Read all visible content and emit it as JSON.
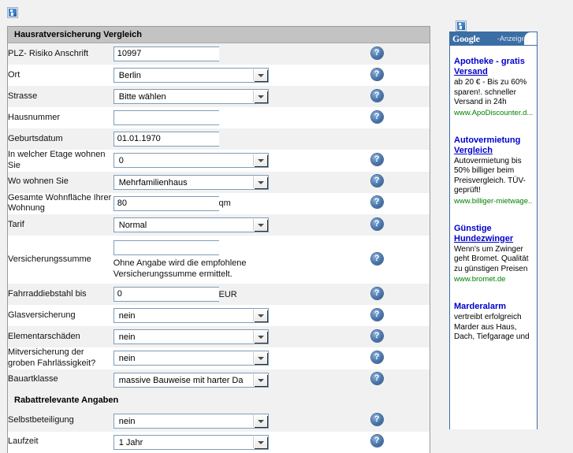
{
  "icons": {
    "broken_image": "broken-image-placeholder",
    "help": "question-mark-help-icon",
    "dropdown": "dropdown-arrow-icon"
  },
  "form": {
    "section_title": "Hausratversicherung Vergleich",
    "subsection_title": "Rabattrelevante Angaben",
    "rows": [
      {
        "label": "PLZ- Risiko Anschrift",
        "type": "text",
        "value": "10997",
        "unit": "",
        "help": true
      },
      {
        "label": "Ort",
        "type": "select",
        "value": "Berlin",
        "unit": "",
        "help": true
      },
      {
        "label": "Strasse",
        "type": "select",
        "value": "Bitte wählen",
        "unit": "",
        "help": true
      },
      {
        "label": "Hausnummer",
        "type": "text",
        "value": "",
        "unit": "",
        "help": true
      },
      {
        "label": "Geburtsdatum",
        "type": "text",
        "value": "01.01.1970",
        "unit": "",
        "help": false
      },
      {
        "label": "In welcher Etage wohnen Sie",
        "type": "select",
        "value": "0",
        "unit": "",
        "help": true
      },
      {
        "label": "Wo wohnen Sie",
        "type": "select",
        "value": "Mehrfamilienhaus",
        "unit": "",
        "help": true
      },
      {
        "label": "Gesamte Wohnfläche Ihrer Wohnung",
        "type": "text",
        "value": "80",
        "unit": "qm",
        "help": true
      },
      {
        "label": "Tarif",
        "type": "select",
        "value": "Normal",
        "unit": "",
        "help": true
      },
      {
        "label": "Versicherungssumme",
        "type": "text-hint",
        "value": "",
        "hint": "Ohne Angabe wird die empfohlene Versicherungssumme ermittelt.",
        "unit": "",
        "help": true
      },
      {
        "label": "Fahrraddiebstahl bis",
        "type": "text",
        "value": "0",
        "unit": "EUR",
        "help": true
      },
      {
        "label": "Glasversicherung",
        "type": "select",
        "value": "nein",
        "unit": "",
        "help": true
      },
      {
        "label": "Elementarschäden",
        "type": "select",
        "value": "nein",
        "unit": "",
        "help": true
      },
      {
        "label": "Mitversicherung der groben Fahrlässigkeit?",
        "type": "select",
        "value": "nein",
        "unit": "",
        "help": true
      },
      {
        "label": "Bauartklasse",
        "type": "select",
        "value": "massive Bauweise mit harter Da",
        "unit": "",
        "help": true
      }
    ],
    "rows_after_subhead": [
      {
        "label": "Selbstbeteiligung",
        "type": "select",
        "value": "nein",
        "unit": "",
        "help": true
      },
      {
        "label": "Laufzeit",
        "type": "select",
        "value": "1 Jahr",
        "unit": "",
        "help": true
      }
    ]
  },
  "ads": {
    "brand": "Google",
    "label": "-Anzeigen",
    "items": [
      {
        "title_line1": "Apotheke - gratis",
        "title_line2": "Versand",
        "body": "ab 20 € - Bis zu 60% sparen!. schneller Versand in 24h",
        "url": "www.ApoDiscounter.d..."
      },
      {
        "title_line1": "Autovermietung",
        "title_line2": "Vergleich",
        "body": "Autovermietung bis 50% billiger beim Preisvergleich. TÜV-geprüft!",
        "url": "www.billiger-mietwage..."
      },
      {
        "title_line1": "Günstige",
        "title_line2": "Hundezwinger",
        "body": "Wenn's um Zwinger geht Bromet. Qualität zu günstigen Preisen",
        "url": "www.bromet.de"
      },
      {
        "title_line1": "Marderalarm",
        "title_line2": "",
        "body": "vertreibt erfolgreich Marder aus Haus, Dach, Tiefgarage und",
        "url": ""
      }
    ]
  }
}
